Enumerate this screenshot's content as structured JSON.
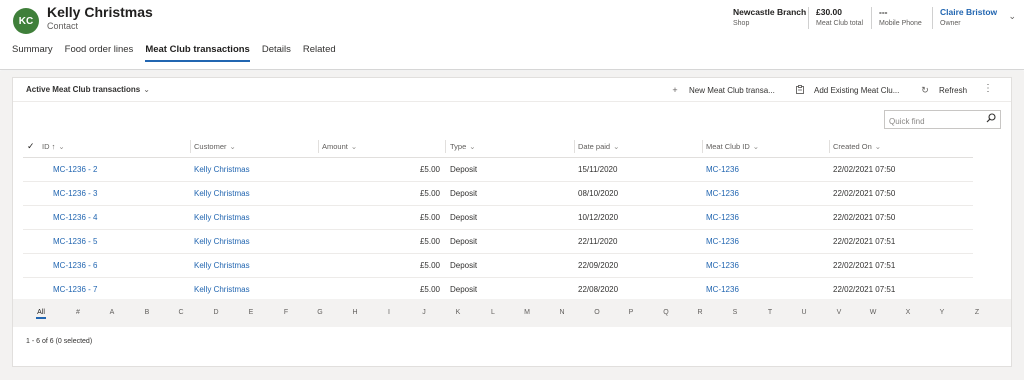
{
  "record": {
    "initials": "KC",
    "name": "Kelly Christmas",
    "type": "Contact",
    "avatar_color": "#3f7f3a"
  },
  "header_fields": [
    {
      "value": "Newcastle Branch",
      "label": "Shop"
    },
    {
      "value": "£30.00",
      "label": "Meat Club total"
    },
    {
      "value": "---",
      "label": "Mobile Phone"
    },
    {
      "value": "Claire Bristow",
      "label": "Owner"
    }
  ],
  "tabs": [
    "Summary",
    "Food order lines",
    "Meat Club transactions",
    "Details",
    "Related"
  ],
  "active_tab": "Meat Club transactions",
  "subgrid": {
    "view_title": "Active Meat Club transactions",
    "commands": {
      "new": "New Meat Club transa...",
      "add_existing": "Add Existing Meat Clu...",
      "refresh": "Refresh"
    },
    "quick_find_placeholder": "Quick find",
    "columns": {
      "id": "ID",
      "customer": "Customer",
      "amount": "Amount",
      "type": "Type",
      "date_paid": "Date paid",
      "meat_club_id": "Meat Club ID",
      "created_on": "Created On"
    },
    "rows": [
      {
        "id": "MC-1236 - 2",
        "customer": "Kelly Christmas",
        "amount": "£5.00",
        "type": "Deposit",
        "date_paid": "15/11/2020",
        "meat_club_id": "MC-1236",
        "created_on": "22/02/2021 07:50"
      },
      {
        "id": "MC-1236 - 3",
        "customer": "Kelly Christmas",
        "amount": "£5.00",
        "type": "Deposit",
        "date_paid": "08/10/2020",
        "meat_club_id": "MC-1236",
        "created_on": "22/02/2021 07:50"
      },
      {
        "id": "MC-1236 - 4",
        "customer": "Kelly Christmas",
        "amount": "£5.00",
        "type": "Deposit",
        "date_paid": "10/12/2020",
        "meat_club_id": "MC-1236",
        "created_on": "22/02/2021 07:50"
      },
      {
        "id": "MC-1236 - 5",
        "customer": "Kelly Christmas",
        "amount": "£5.00",
        "type": "Deposit",
        "date_paid": "22/11/2020",
        "meat_club_id": "MC-1236",
        "created_on": "22/02/2021 07:51"
      },
      {
        "id": "MC-1236 - 6",
        "customer": "Kelly Christmas",
        "amount": "£5.00",
        "type": "Deposit",
        "date_paid": "22/09/2020",
        "meat_club_id": "MC-1236",
        "created_on": "22/02/2021 07:51"
      },
      {
        "id": "MC-1236 - 7",
        "customer": "Kelly Christmas",
        "amount": "£5.00",
        "type": "Deposit",
        "date_paid": "22/08/2020",
        "meat_club_id": "MC-1236",
        "created_on": "22/02/2021 07:51"
      }
    ],
    "jump_letters": [
      "All",
      "#",
      "A",
      "B",
      "C",
      "D",
      "E",
      "F",
      "G",
      "H",
      "I",
      "J",
      "K",
      "L",
      "M",
      "N",
      "O",
      "P",
      "Q",
      "R",
      "S",
      "T",
      "U",
      "V",
      "W",
      "X",
      "Y",
      "Z"
    ],
    "footer": "1 - 6 of 6 (0 selected)"
  },
  "colors": {
    "accent": "#2266b1",
    "link": "#2266b1",
    "background": "#f3f2f1"
  }
}
